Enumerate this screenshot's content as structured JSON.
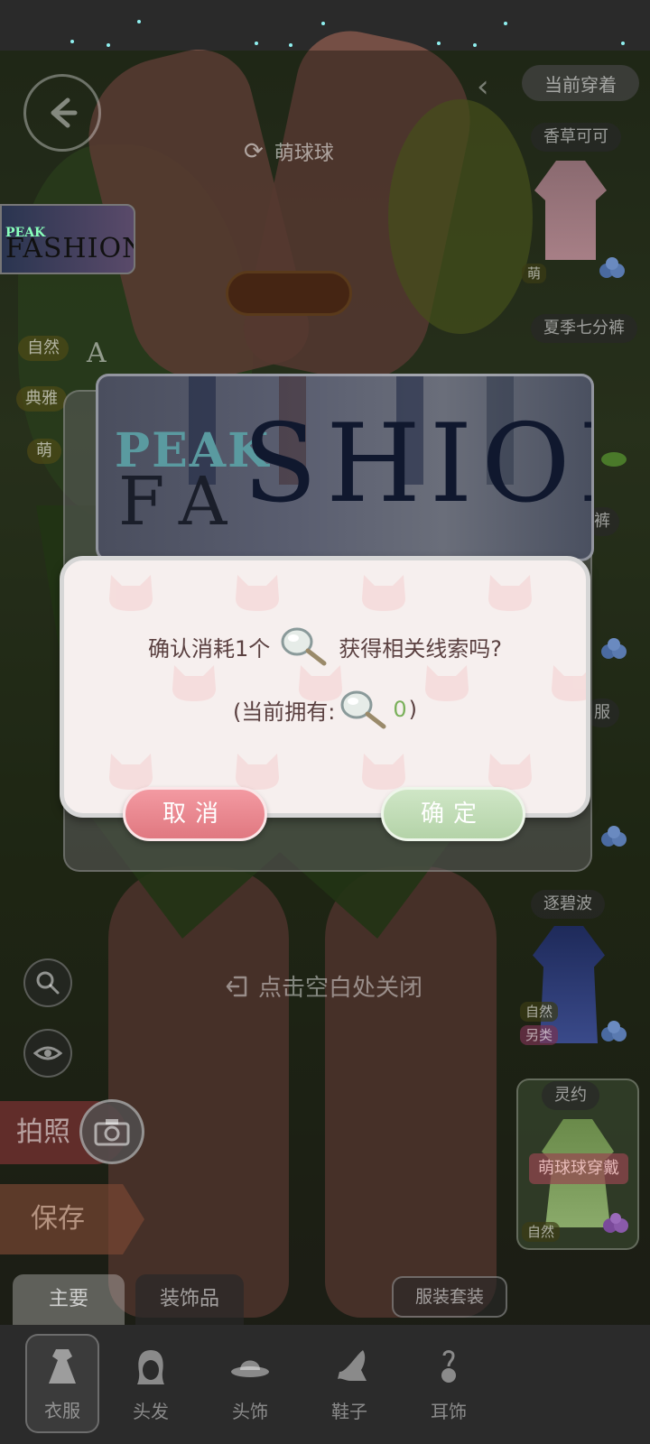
{
  "header": {
    "back_icon": "arrow-left-icon",
    "character_name": "萌球球",
    "swap_icon": "refresh-icon"
  },
  "mini_banner": {
    "line1": "PEAK",
    "line2": "FASHION"
  },
  "left_tags": [
    "自然",
    "典雅",
    "萌"
  ],
  "left_letter": "A",
  "right_panel": {
    "current_label": "当前穿着",
    "items": [
      {
        "name": "香草可可",
        "tag": "萌"
      },
      {
        "name": "夏季七分裤"
      },
      {
        "name": "裤"
      },
      {
        "name": "服"
      },
      {
        "name": "逐碧波",
        "tags": [
          "自然",
          "另类"
        ]
      },
      {
        "name": "灵约",
        "action": "萌球球穿戴",
        "tag": "自然"
      }
    ]
  },
  "tools": {
    "search_icon": "search-icon",
    "eye_icon": "eye-icon",
    "photo_label": "拍照",
    "camera_icon": "camera-icon",
    "save_label": "保存"
  },
  "close_hint": "点击空白处关闭",
  "tabs": {
    "main": "主要",
    "accessories": "装饰品",
    "suit": "服装套装"
  },
  "bottom_nav": [
    {
      "label": "衣服",
      "icon": "dress-icon",
      "active": true
    },
    {
      "label": "头发",
      "icon": "hair-icon",
      "active": false
    },
    {
      "label": "头饰",
      "icon": "hat-icon",
      "active": false
    },
    {
      "label": "鞋子",
      "icon": "heel-shoe-icon",
      "active": false
    },
    {
      "label": "耳饰",
      "icon": "earring-icon",
      "active": false
    }
  ],
  "banner": {
    "peak": "PEAK",
    "fa": "FA",
    "shion": "SHION"
  },
  "dialog": {
    "confirm_prefix": "确认消耗1个",
    "confirm_suffix": "获得相关线索吗?",
    "item_icon": "magnifying-glass-icon",
    "owned_prefix": "(当前拥有:",
    "owned_count": "0",
    "owned_suffix": ")",
    "cancel_label": "取消",
    "ok_label": "确定"
  },
  "colors": {
    "dialog_bg": "#f6efee",
    "cancel": "#e98890",
    "ok": "#c4ddb8",
    "count_green": "#7ab05a"
  }
}
